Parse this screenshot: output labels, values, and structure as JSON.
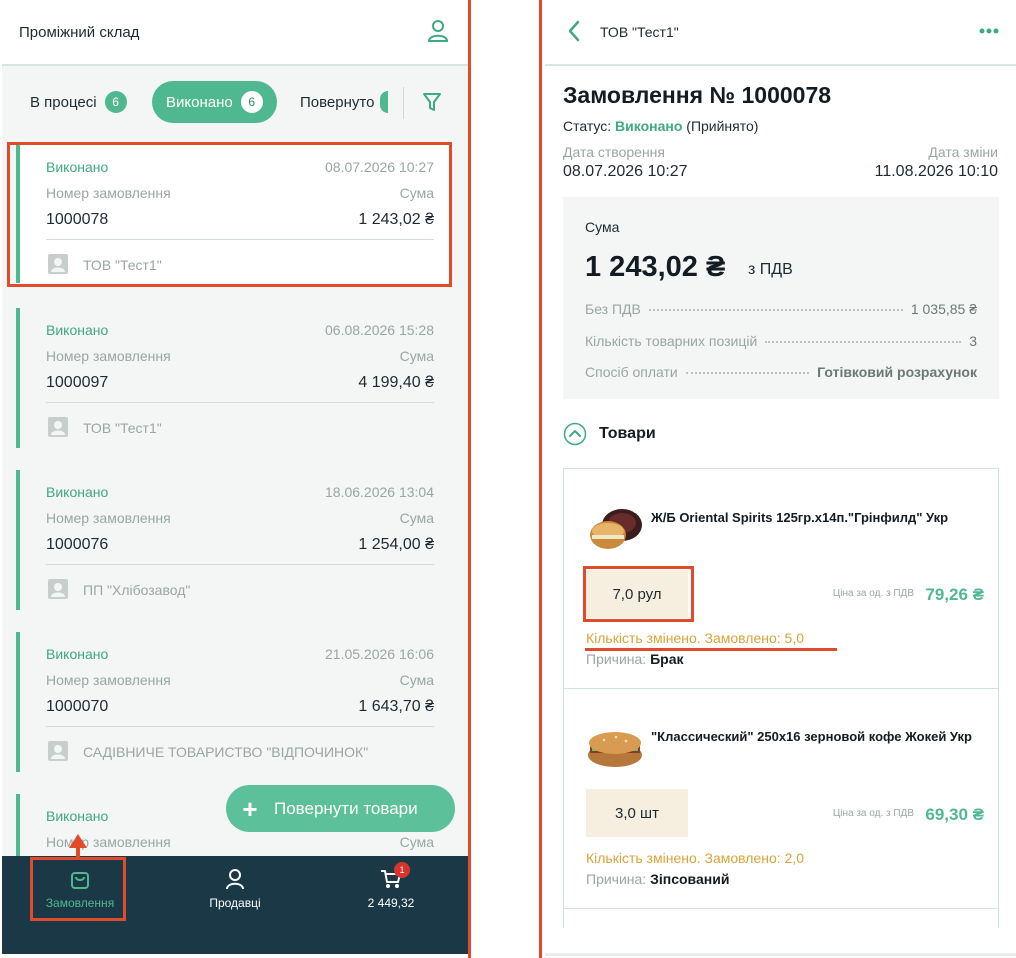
{
  "left": {
    "header_title": "Проміжний склад",
    "tabs": [
      {
        "label": "В процесі",
        "count": "6"
      },
      {
        "label": "Виконано",
        "count": "6"
      },
      {
        "label": "Повернуто"
      }
    ],
    "orders": [
      {
        "status": "Виконано",
        "date": "08.07.2026 10:27",
        "number_label": "Номер замовлення",
        "sum_label": "Сума",
        "number": "1000078",
        "sum": "1 243,02 ₴",
        "client": "ТОВ \"Тест1\""
      },
      {
        "status": "Виконано",
        "date": "06.08.2026 15:28",
        "number_label": "Номер замовлення",
        "sum_label": "Сума",
        "number": "1000097",
        "sum": "4 199,40 ₴",
        "client": "ТОВ \"Тест1\""
      },
      {
        "status": "Виконано",
        "date": "18.06.2026 13:04",
        "number_label": "Номер замовлення",
        "sum_label": "Сума",
        "number": "1000076",
        "sum": "1 254,00 ₴",
        "client": "ПП \"Хлібозавод\""
      },
      {
        "status": "Виконано",
        "date": "21.05.2026 16:06",
        "number_label": "Номер замовлення",
        "sum_label": "Сума",
        "number": "1000070",
        "sum": "1 643,70 ₴",
        "client": "САДІВНИЧЕ ТОВАРИСТВО \"ВІДПОЧИНОК\""
      },
      {
        "status": "Виконано",
        "number_label": "Номер замовлення",
        "sum_label": "Сума"
      }
    ],
    "fab_label": "Повернути товари",
    "nav": {
      "orders": "Замовлення",
      "sellers": "Продавці",
      "cart_total": "2 449,32",
      "cart_badge": "1"
    }
  },
  "right": {
    "header_title": "ТОВ \"Тест1\"",
    "order_title": "Замовлення № 1000078",
    "status_label": "Статус:",
    "status_value": "Виконано",
    "status_note": "(Прийнято)",
    "created_label": "Дата створення",
    "created_value": "08.07.2026 10:27",
    "changed_label": "Дата зміни",
    "changed_value": "11.08.2026 10:10",
    "sum_label": "Сума",
    "sum_amount": "1 243,02 ₴",
    "sum_vat": "з ПДВ",
    "rows": [
      {
        "label": "Без ПДВ",
        "value": "1 035,85 ₴"
      },
      {
        "label": "Кількість товарних позицій",
        "value": "3"
      },
      {
        "label": "Спосіб оплати",
        "value": "Готівковий розрахунок"
      }
    ],
    "goods_title": "Товари",
    "goods": [
      {
        "name": "Ж/Б Oriental Spirits 125гр.х14п.\"Грінфилд\" Укр",
        "qty": "7,0 рул",
        "price_label": "Ціна за од. з ПДВ",
        "price": "79,26 ₴",
        "changed": "Кількість змінено. Замовлено: 5,0",
        "reason_label": "Причина:",
        "reason": "Брак"
      },
      {
        "name": "\"Классический\"  250х16 зерновой кофе Жокей Укр",
        "qty": "3,0 шт",
        "price_label": "Ціна за од. з ПДВ",
        "price": "69,30 ₴",
        "changed": "Кількість змінено. Замовлено: 2,0",
        "reason_label": "Причина:",
        "reason": "Зіпсований"
      }
    ]
  },
  "colors": {
    "accent": "#4fb890",
    "annotation": "#e04b2c",
    "nav_bg": "#1b3847",
    "warning": "#d9a33a"
  },
  "icons": [
    "user-icon",
    "filter-icon",
    "avatar-icon",
    "plus-icon",
    "bag-icon",
    "person-icon",
    "cart-icon",
    "back-chevron-icon",
    "more-dots-icon",
    "collapse-chevron-icon"
  ]
}
